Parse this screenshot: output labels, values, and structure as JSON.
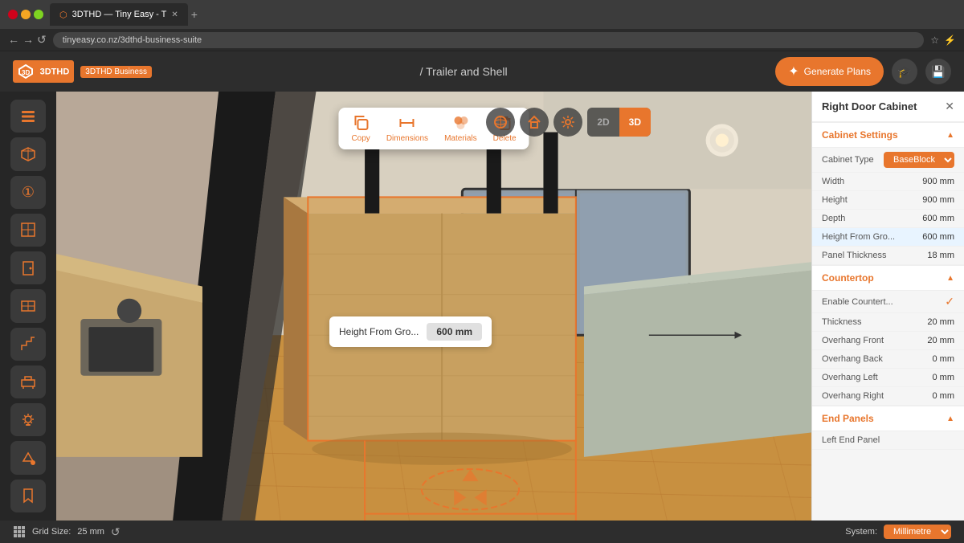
{
  "browser": {
    "tab_label": "3DTHD — Tiny Easy - T",
    "url": "tinyeasy.co.nz/3dthd-business-suite",
    "add_tab_label": "+"
  },
  "header": {
    "logo_text": "3DTHD",
    "business_label": "3DTHD Business",
    "title": "/ Trailer and Shell",
    "generate_btn": "Generate Plans",
    "learn_icon": "graduation-cap-icon",
    "save_icon": "floppy-disk-icon"
  },
  "floating_toolbar": {
    "copy_label": "Copy",
    "dimensions_label": "Dimensions",
    "materials_label": "Materials",
    "delete_label": "Delete"
  },
  "dimension_tooltip": {
    "label": "Height From Gro...",
    "value": "600 mm"
  },
  "view_controls": {
    "orbit_icon": "orbit-icon",
    "home_icon": "home-icon",
    "settings_icon": "settings-icon",
    "mode_2d": "2D",
    "mode_3d": "3D",
    "active_mode": "3D"
  },
  "right_panel": {
    "title": "Right Door Cabinet",
    "close_icon": "close-icon",
    "sections": [
      {
        "id": "cabinet-settings",
        "label": "Cabinet Settings",
        "expanded": true,
        "properties": [
          {
            "label": "Cabinet Type",
            "value": "BaseBlock",
            "type": "select"
          },
          {
            "label": "Width",
            "value": "900 mm"
          },
          {
            "label": "Height",
            "value": "900 mm"
          },
          {
            "label": "Depth",
            "value": "600 mm"
          },
          {
            "label": "Height From Gro...",
            "value": "600 mm",
            "highlighted": true
          },
          {
            "label": "Panel Thickness",
            "value": "18 mm"
          }
        ]
      },
      {
        "id": "countertop",
        "label": "Countertop",
        "expanded": true,
        "properties": [
          {
            "label": "Enable Countert...",
            "value": "✓",
            "type": "check"
          },
          {
            "label": "Thickness",
            "value": "20 mm"
          },
          {
            "label": "Overhang Front",
            "value": "20 mm"
          },
          {
            "label": "Overhang Back",
            "value": "0 mm"
          },
          {
            "label": "Overhang Left",
            "value": "0 mm"
          },
          {
            "label": "Overhang Right",
            "value": "0 mm"
          }
        ]
      },
      {
        "id": "end-panels",
        "label": "End Panels",
        "expanded": true,
        "properties": [
          {
            "label": "Left End Panel",
            "value": ""
          }
        ]
      }
    ]
  },
  "footer": {
    "grid_label": "Grid Size:",
    "grid_value": "25 mm",
    "reset_icon": "reset-icon",
    "system_label": "System:",
    "unit_value": "Millimetre"
  },
  "left_toolbar": {
    "tools": [
      {
        "id": "layers",
        "icon": "layers-icon",
        "symbol": "⊞"
      },
      {
        "id": "view",
        "icon": "cube-icon",
        "symbol": "◈"
      },
      {
        "id": "walls",
        "icon": "wall-icon",
        "symbol": "❑"
      },
      {
        "id": "windows",
        "icon": "window-icon",
        "symbol": "⊟"
      },
      {
        "id": "doors",
        "icon": "door-icon",
        "symbol": "▭"
      },
      {
        "id": "cabinets",
        "icon": "cabinet-icon",
        "symbol": "⊞"
      },
      {
        "id": "stairs",
        "icon": "stairs-icon",
        "symbol": "≡"
      },
      {
        "id": "furniture",
        "icon": "furniture-icon",
        "symbol": "⊓"
      },
      {
        "id": "lighting",
        "icon": "light-icon",
        "symbol": "☀"
      },
      {
        "id": "fill",
        "icon": "fill-icon",
        "symbol": "◈"
      },
      {
        "id": "bookmark",
        "icon": "bookmark-icon",
        "symbol": "⊿"
      }
    ]
  }
}
